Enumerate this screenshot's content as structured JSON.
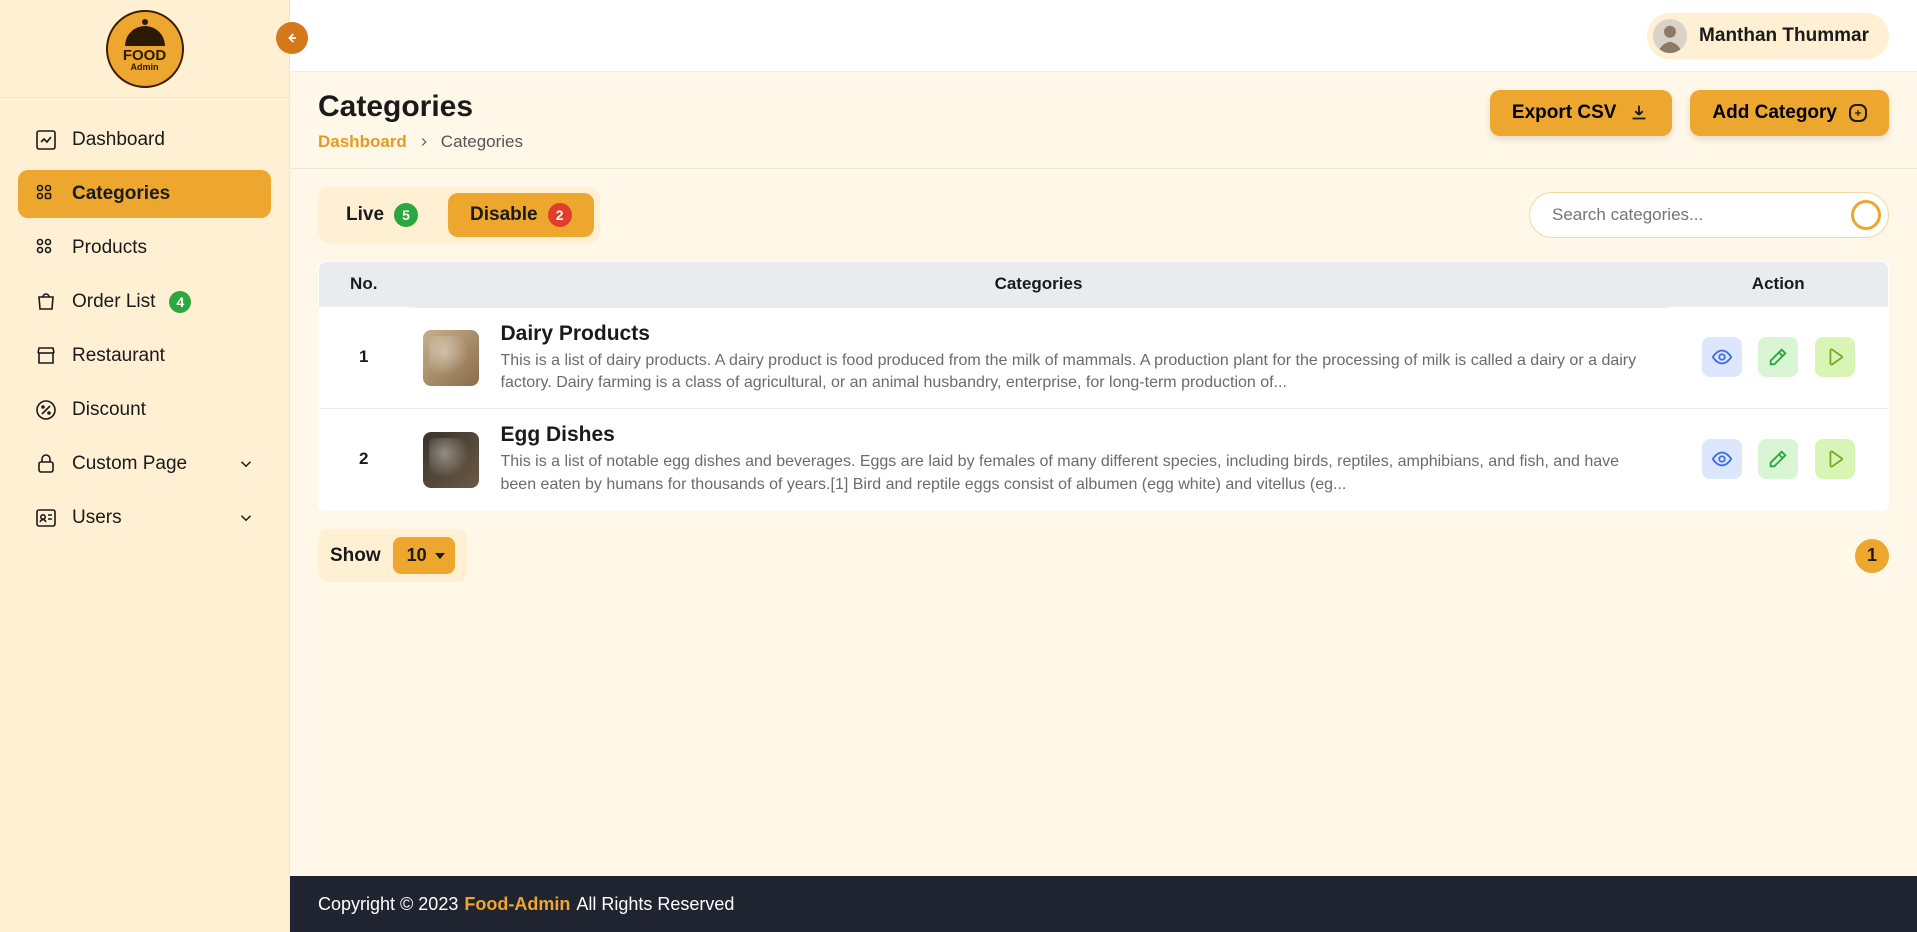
{
  "brand": {
    "line1": "FOOD",
    "line2": "Admin"
  },
  "user": {
    "name": "Manthan Thummar"
  },
  "sidebar": {
    "items": [
      {
        "label": "Dashboard"
      },
      {
        "label": "Categories"
      },
      {
        "label": "Products"
      },
      {
        "label": "Order List",
        "badge": "4"
      },
      {
        "label": "Restaurant"
      },
      {
        "label": "Discount"
      },
      {
        "label": "Custom Page"
      },
      {
        "label": "Users"
      }
    ]
  },
  "page": {
    "title": "Categories",
    "breadcrumb_root": "Dashboard",
    "breadcrumb_current": "Categories"
  },
  "actions": {
    "export_csv": "Export CSV",
    "add_category": "Add Category"
  },
  "tabs": {
    "live_label": "Live",
    "live_count": "5",
    "disable_label": "Disable",
    "disable_count": "2"
  },
  "search": {
    "placeholder": "Search categories..."
  },
  "table": {
    "headers": {
      "no": "No.",
      "categories": "Categories",
      "action": "Action"
    },
    "rows": [
      {
        "no": "1",
        "title": "Dairy Products",
        "desc": "This is a list of dairy products. A dairy product is food produced from the milk of mammals. A production plant for the processing of milk is called a dairy or a dairy factory. Dairy farming is a class of agricultural, or an animal husbandry, enterprise, for long-term production of..."
      },
      {
        "no": "2",
        "title": "Egg Dishes",
        "desc": "This is a list of notable egg dishes and beverages. Eggs are laid by females of many different species, including birds, reptiles, amphibians, and fish, and have been eaten by humans for thousands of years.[1] Bird and reptile eggs consist of albumen (egg white) and vitellus (eg..."
      }
    ]
  },
  "pagination": {
    "show_label": "Show",
    "page_size": "10",
    "current_page": "1"
  },
  "footer": {
    "prefix": "Copyright © 2023",
    "brand": "Food-Admin",
    "suffix": "All Rights Reserved"
  }
}
